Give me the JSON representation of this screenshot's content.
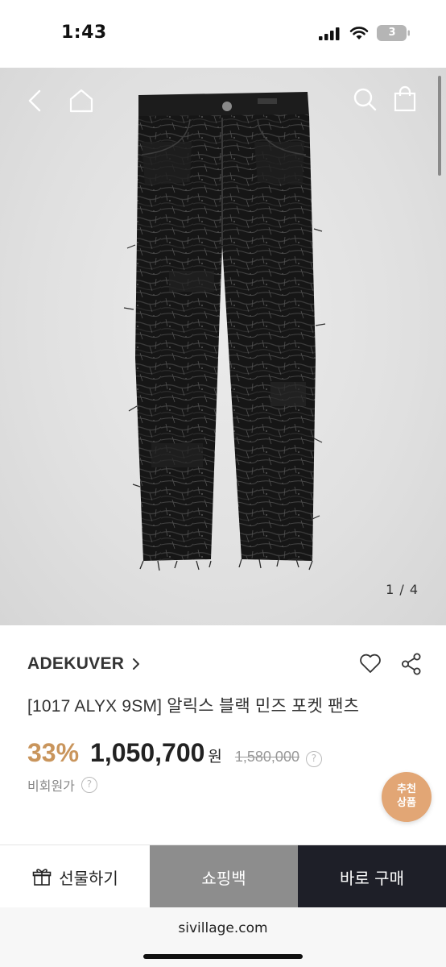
{
  "status_bar": {
    "time": "1:43",
    "battery_level": "3",
    "icons": [
      "cellular-signal-icon",
      "wifi-icon",
      "battery-icon"
    ]
  },
  "gallery": {
    "page_indicator": "1 / 4",
    "nav_icons": [
      "back-chevron-icon",
      "home-icon",
      "search-icon",
      "shopping-bag-icon"
    ]
  },
  "product": {
    "brand": "ADEKUVER",
    "title": "[1017 ALYX 9SM] 알릭스 블랙 민즈 포켓 팬츠",
    "discount": "33%",
    "price": "1,050,700",
    "currency": "원",
    "original_price": "1,580,000",
    "help_mark": "?",
    "member_price_label": "비회원가",
    "action_icons": [
      "heart-icon",
      "share-icon"
    ]
  },
  "recommend_badge": {
    "line1": "추천",
    "line2": "상품"
  },
  "actions": {
    "gift_label": "선물하기",
    "bag_label": "쇼핑백",
    "buy_label": "바로 구매"
  },
  "browser": {
    "url": "sivillage.com"
  },
  "colors": {
    "discount": "#c9955c",
    "recommend_badge": "#e2a675",
    "bag_button": "#8d8d8d",
    "buy_button": "#1e1f28",
    "hero_background": "#e3e3e3"
  }
}
